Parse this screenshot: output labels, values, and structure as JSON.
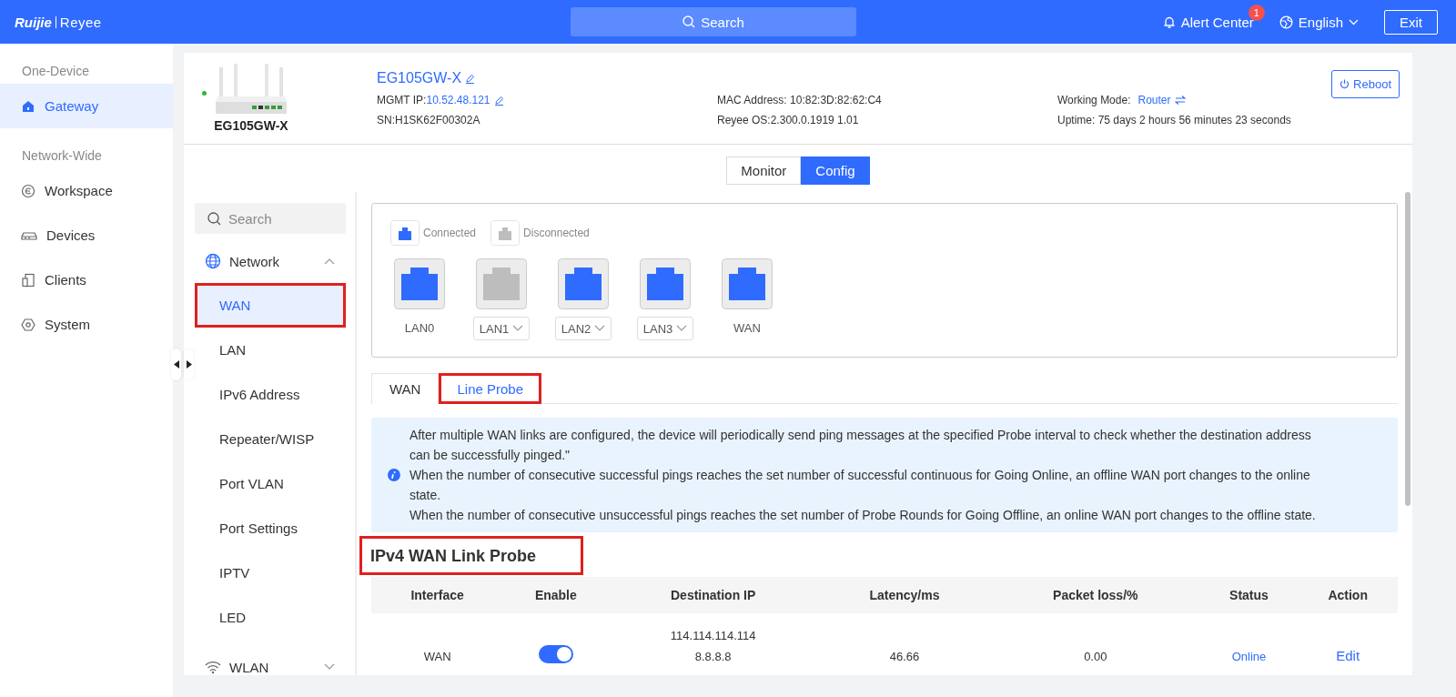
{
  "topbar": {
    "logo": {
      "brand": "Ruijie",
      "product": "Reyee"
    },
    "search": {
      "placeholder": "Search"
    },
    "alert": {
      "label": "Alert Center",
      "count": "1"
    },
    "language": "English",
    "exit": "Exit"
  },
  "sidebar": {
    "sections": [
      {
        "title": "One-Device",
        "items": [
          {
            "label": "Gateway",
            "kind": "home",
            "selected": true
          }
        ]
      },
      {
        "title": "Network-Wide",
        "items": [
          {
            "label": "Workspace",
            "kind": "workspace",
            "selected": false
          },
          {
            "label": "Devices",
            "kind": "devices",
            "selected": false
          },
          {
            "label": "Clients",
            "kind": "clients",
            "selected": false
          },
          {
            "label": "System",
            "kind": "system",
            "selected": false
          }
        ]
      }
    ]
  },
  "device": {
    "online": true,
    "model": "EG105GW-X",
    "name": "EG105GW-X",
    "mgmt_ip_label": "MGMT IP:",
    "mgmt_ip": "10.52.48.121",
    "sn": "SN:H1SK62F00302A",
    "mac": "MAC Address: 10:82:3D:82:62:C4",
    "os": "Reyee OS:2.300.0.1919 1.01",
    "mode_label": "Working Mode:",
    "mode": "Router",
    "uptime": "Uptime: 75 days 2 hours 56 minutes 23 seconds",
    "reboot": "Reboot"
  },
  "view_tabs": [
    {
      "label": "Monitor",
      "selected": false
    },
    {
      "label": "Config",
      "selected": true
    }
  ],
  "menu": {
    "search": {
      "placeholder": "Search"
    },
    "groups": [
      {
        "label": "Network",
        "kind": "globe",
        "expanded": true,
        "children": [
          {
            "label": "WAN",
            "selected": true,
            "highlighted": true
          },
          {
            "label": "LAN",
            "selected": false,
            "highlighted": false
          },
          {
            "label": "IPv6 Address",
            "selected": false,
            "highlighted": false
          },
          {
            "label": "Repeater/WISP",
            "selected": false,
            "highlighted": false
          },
          {
            "label": "Port VLAN",
            "selected": false,
            "highlighted": false
          },
          {
            "label": "Port Settings",
            "selected": false,
            "highlighted": false
          },
          {
            "label": "IPTV",
            "selected": false,
            "highlighted": false
          },
          {
            "label": "LED",
            "selected": false,
            "highlighted": false
          }
        ]
      },
      {
        "label": "WLAN",
        "kind": "wifi",
        "expanded": false
      }
    ]
  },
  "ports": {
    "legend": [
      {
        "label": "Connected",
        "connected": true
      },
      {
        "label": "Disconnected",
        "connected": false
      }
    ],
    "items": [
      {
        "label": "LAN0",
        "connected": true,
        "dropdown": false
      },
      {
        "label": "LAN1",
        "connected": false,
        "dropdown": true
      },
      {
        "label": "LAN2",
        "connected": true,
        "dropdown": true
      },
      {
        "label": "LAN3",
        "connected": true,
        "dropdown": true
      },
      {
        "label": "WAN",
        "connected": true,
        "dropdown": false
      }
    ]
  },
  "sub_tabs": [
    {
      "label": "WAN",
      "selected": false,
      "highlighted": false
    },
    {
      "label": "Line Probe",
      "selected": true,
      "highlighted": true
    }
  ],
  "notice": {
    "lines": [
      "After multiple WAN links are configured, the device will periodically send ping messages at the specified Probe interval to check whether the destination address can be successfully pinged.\"",
      "When the number of consecutive successful pings reaches the set number of successful continuous for Going Online, an offline WAN port changes to the online state.",
      "When the number of consecutive unsuccessful pings reaches the set number of Probe Rounds for Going Offline, an online WAN port changes to the offline state."
    ]
  },
  "section_title": {
    "text": "IPv4 WAN Link Probe",
    "highlighted": true
  },
  "table": {
    "columns": [
      "Interface",
      "Enable",
      "Destination IP",
      "Latency/ms",
      "Packet loss/%",
      "Status",
      "Action"
    ],
    "rows": [
      {
        "interface": "WAN",
        "enable": true,
        "destination_ips": [
          "114.114.114.114",
          "8.8.8.8"
        ],
        "latency": "46.66",
        "packet_loss": "0.00",
        "status": "Online",
        "action": "Edit"
      }
    ]
  }
}
